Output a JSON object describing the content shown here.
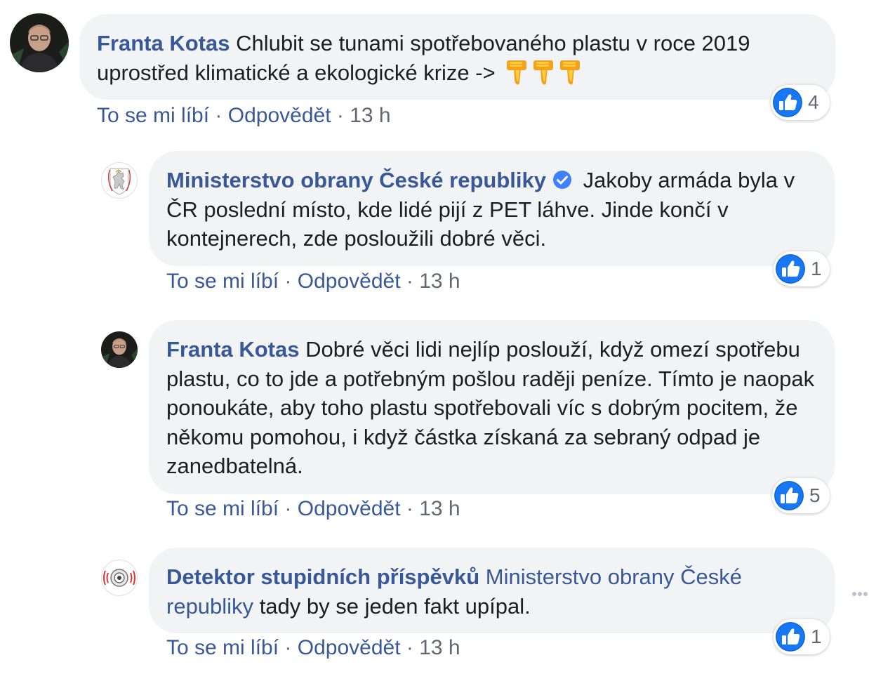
{
  "actions": {
    "like_label": "To se mi líbí",
    "reply_label": "Odpovědět",
    "separator": "·"
  },
  "comments": [
    {
      "author": "Franta Kotas",
      "text": "Chlubit se tunami spotřebovaného plastu v roce 2019 uprostřed klimatické a ekologické krize ->",
      "time": "13 h",
      "likes": "4"
    },
    {
      "author": "Ministerstvo obrany České republiky",
      "text": "Jakoby armáda byla v ČR poslední místo, kde lidé pijí z PET láhve. Jinde končí v kontejnerech, zde posloužili dobré věci.",
      "time": "13 h",
      "likes": "1"
    },
    {
      "author": "Franta Kotas",
      "text": "Dobré věci lidi nejlíp poslouží, když omezí spotřebu plastu, co to jde a potřebným pošlou raději peníze. Tímto je naopak ponoukáte, aby toho plastu spotřebovali víc s dobrým pocitem, že někomu pomohou, i když částka získaná za sebraný odpad je zanedbatelná.",
      "time": "13 h",
      "likes": "5"
    },
    {
      "author": "Detektor stupidních příspěvků",
      "mention": "Ministerstvo obrany České republiky",
      "text": "tady by se jeden fakt upípal.",
      "time": "13 h",
      "likes": "1"
    }
  ],
  "icons": {
    "thumbs_down": "thumbs-down-emoji",
    "verified": "verified-badge-icon",
    "like": "like-reaction-icon",
    "more": "more-options-icon"
  },
  "colors": {
    "link_blue": "#385898",
    "bubble_bg": "#f2f3f5",
    "like_blue": "#1877f2",
    "meta_gray": "#606770"
  }
}
